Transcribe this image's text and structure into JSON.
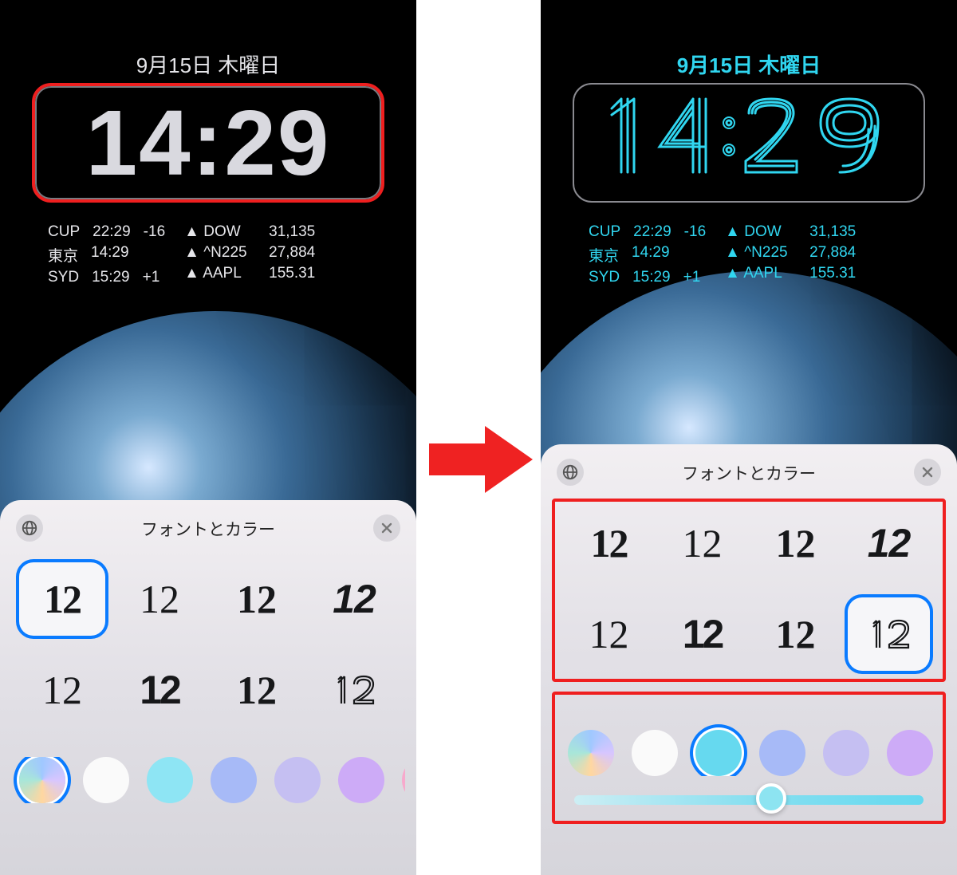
{
  "date_label": "9月15日 木曜日",
  "time": "14:29",
  "widgets": {
    "clocks": [
      {
        "city": "CUP",
        "time": "22:29",
        "offset": "-16"
      },
      {
        "city": "東京",
        "time": "14:29",
        "offset": ""
      },
      {
        "city": "SYD",
        "time": "15:29",
        "offset": "+1"
      }
    ],
    "stocks": [
      {
        "sym": "DOW",
        "val": "31,135"
      },
      {
        "sym": "^N225",
        "val": "27,884"
      },
      {
        "sym": "AAPL",
        "val": "155.31"
      }
    ]
  },
  "sheet": {
    "title": "フォントとカラー",
    "font_sample": "12",
    "left_selected_font_index": 0,
    "right_selected_font_index": 7,
    "colors": [
      {
        "key": "gradient"
      },
      {
        "key": "white"
      },
      {
        "key": "cyan"
      },
      {
        "key": "blue"
      },
      {
        "key": "lavender"
      },
      {
        "key": "purple"
      },
      {
        "key": "pink"
      }
    ],
    "left_selected_color_index": 0,
    "right_selected_color_index": 2,
    "right_slider_pct": 52
  },
  "accent_cyan": "#30d6f0",
  "highlight_red": "#ef1f1f"
}
